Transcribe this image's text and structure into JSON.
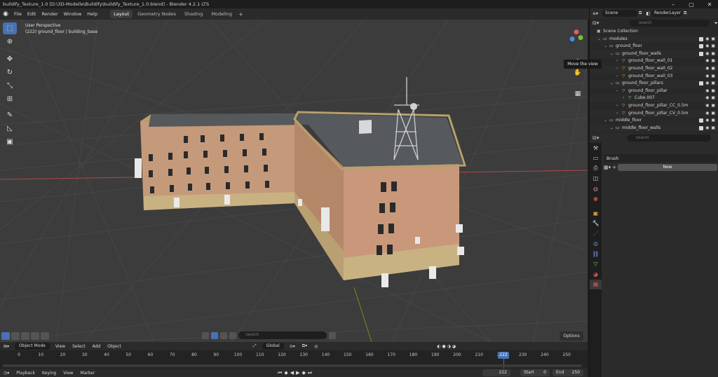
{
  "window": {
    "title": "buildify_Texture_1.0 [D:\\3D-Modelle\\Buildify\\buildify_Texture_1.0.blend] - Blender 4.2.1 LTS"
  },
  "menu": {
    "items": [
      "File",
      "Edit",
      "Render",
      "Window",
      "Help"
    ],
    "workspaces": [
      "Layout",
      "Geometry Nodes",
      "Shading",
      "Modeling"
    ],
    "active_workspace": "Layout"
  },
  "viewport": {
    "view_name": "User Perspective",
    "object_info": "(222) ground_floor | building_base",
    "tooltip": "Move the view",
    "search_placeholder": "Search",
    "options_label": "Options"
  },
  "header": {
    "mode": "Object Mode",
    "menus": [
      "View",
      "Select",
      "Add",
      "Object"
    ],
    "orientation": "Global"
  },
  "timeline": {
    "ticks": [
      0,
      10,
      20,
      30,
      40,
      50,
      60,
      70,
      80,
      90,
      100,
      110,
      120,
      130,
      140,
      150,
      160,
      170,
      180,
      190,
      200,
      210,
      220,
      230,
      240,
      250
    ],
    "current_frame": "222",
    "playback_label": "Playback",
    "keying_label": "Keying",
    "view_label": "View",
    "marker_label": "Marker",
    "frame_field": "222",
    "start_label": "Start",
    "start_value": "0",
    "end_label": "End",
    "end_value": "250"
  },
  "outliner": {
    "scene_label": "Scene",
    "view_layer_label": "RenderLayer",
    "search_placeholder": "Search",
    "rows": [
      {
        "label": "Scene Collection",
        "indent": 0,
        "kind": "scene"
      },
      {
        "label": "modules",
        "indent": 1,
        "kind": "collection"
      },
      {
        "label": "ground_floor",
        "indent": 2,
        "kind": "collection"
      },
      {
        "label": "ground_floor_walls",
        "indent": 3,
        "kind": "collection"
      },
      {
        "label": "ground_floor_wall_01",
        "indent": 4,
        "kind": "object"
      },
      {
        "label": "ground_floor_wall_02",
        "indent": 4,
        "kind": "object"
      },
      {
        "label": "ground_floor_wall_03",
        "indent": 4,
        "kind": "object"
      },
      {
        "label": "ground_floor_pillars",
        "indent": 3,
        "kind": "collection"
      },
      {
        "label": "ground_floor_pillar",
        "indent": 4,
        "kind": "object"
      },
      {
        "label": "Cube.007",
        "indent": 5,
        "kind": "mesh"
      },
      {
        "label": "ground_floor_pillar_CC_0.5m",
        "indent": 4,
        "kind": "object"
      },
      {
        "label": "ground_floor_pillar_CV_0.5m",
        "indent": 4,
        "kind": "object"
      },
      {
        "label": "middle_floor",
        "indent": 2,
        "kind": "collection"
      },
      {
        "label": "middle_floor_walls",
        "indent": 3,
        "kind": "collection"
      }
    ]
  },
  "properties": {
    "search_placeholder": "Search",
    "brush_label": "Brush",
    "new_label": "New"
  },
  "colors": {
    "accent": "#4772b3",
    "viewport_bg": "#3c3c3c",
    "panel_bg": "#2b2b2b",
    "axis_red": "#b0474e",
    "axis_green": "#6a8f2e"
  }
}
